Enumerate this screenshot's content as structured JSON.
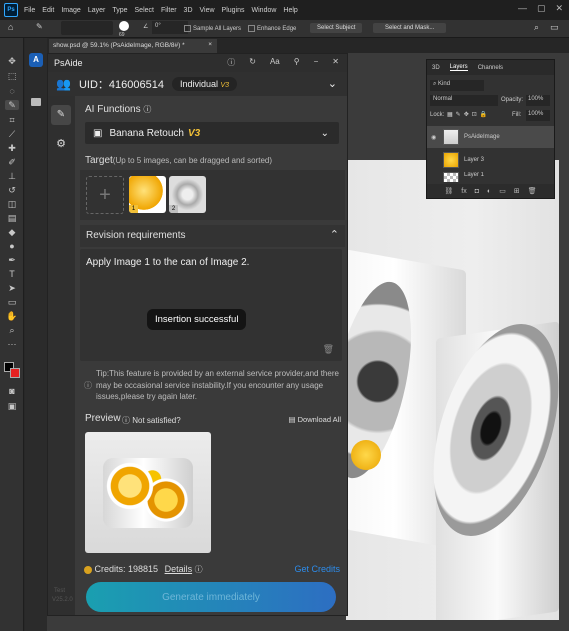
{
  "menubar": {
    "app_badge": "Ps",
    "items": [
      "File",
      "Edit",
      "Image",
      "Layer",
      "Type",
      "Select",
      "Filter",
      "3D",
      "View",
      "Plugins",
      "Window",
      "Help"
    ],
    "window_controls": [
      "—",
      "▢",
      "✕"
    ]
  },
  "options_bar": {
    "brush_size": "69",
    "angle": "0°",
    "sample_all_layers": "Sample All Layers",
    "enhance_edge": "Enhance Edge",
    "select_subject": "Select Subject",
    "select_and_mask": "Select and Mask..."
  },
  "document_tab": {
    "title": "show.psd @ 59.1% (PsAideImage, RGB/8#) *",
    "close": "×"
  },
  "layers_panel": {
    "tabs": [
      "3D",
      "Layers",
      "Channels"
    ],
    "active_tab": "Layers",
    "filter_kind": "Kind",
    "blend_mode": "Normal",
    "opacity_label": "Opacity:",
    "opacity_value": "100%",
    "lock_label": "Lock:",
    "fill_label": "Fill:",
    "fill_value": "100%",
    "layers": [
      {
        "name": "PsAideImage"
      },
      {
        "name": "Layer 3"
      },
      {
        "name": "Layer 1"
      }
    ]
  },
  "psaide": {
    "title": "PsAide",
    "uid_label": "UID：416006514",
    "plan": "Individual",
    "plan_tag": "V3",
    "ai_functions_label": "AI Functions",
    "function_selected": "Banana Retouch",
    "function_version": "V3",
    "target_label": "Target",
    "target_hint": "(Up to 5 images, can be dragged and sorted)",
    "target_images": [
      {
        "index": "1",
        "badge_color": "#f2c037"
      },
      {
        "index": "2",
        "badge_color": "#bfbfbf"
      }
    ],
    "revision_label": "Revision requirements",
    "revision_text": "Apply Image 1 to the can of Image 2.",
    "toast": "Insertion successful",
    "tip": "Tip:This feature is provided by an external service provider,and there may be occasional service instability.If you encounter any usage issues,please try again later.",
    "preview_label": "Preview",
    "not_satisfied": "Not satisfied?",
    "download_all": "Download All",
    "credits_label": "Credits: 198815",
    "details": "Details",
    "get_credits": "Get Credits",
    "generate_button": "Generate immediately",
    "test_tag": "Test",
    "version": "V25.2.0"
  },
  "colors": {
    "accent_blue": "#2d8ceb",
    "highlight_gold": "#f2c037"
  }
}
